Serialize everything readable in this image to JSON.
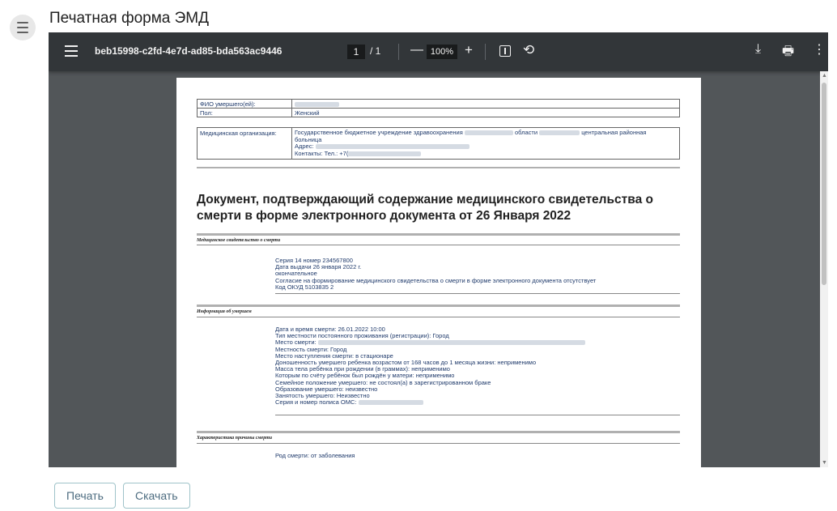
{
  "header": {
    "title": "Печатная форма ЭМД"
  },
  "viewer": {
    "file_name": "beb15998-c2fd-4e7d-ad85-bda563ac9446",
    "current_page": "1",
    "page_total": "/ 1",
    "zoom_out": "—",
    "zoom": "100%",
    "zoom_in": "+",
    "rotate": "⟲",
    "download": "⤓",
    "print": "🖶",
    "more": "⋮"
  },
  "document": {
    "patient_table": {
      "name_label": "ФИО умершего(ей):",
      "name_value": "",
      "sex_label": "Пол:",
      "sex_value": "Женский"
    },
    "org_table": {
      "label": "Медицинская организация:",
      "line1_a": "Государственное бюджетное учреждение здравоохранения",
      "line1_b": "области",
      "line1_c": "центральная районная",
      "line2": "больница",
      "address_label": "Адрес:",
      "contacts_label": "Контакты: Тел.: +7("
    },
    "title": "Документ, подтверждающий содержание медицинского свидетельства о смерти в форме электронного документа от 26 Января 2022",
    "section1": {
      "title": "Медицинское свидетельство о смерти",
      "lines": [
        "Серия 14 номер 234567800",
        "Дата выдачи 26 января 2022 г.",
        "окончательное",
        "Согласие на формирование медицинского свидетельства о смерти в форме электронного документа отсутствует",
        "Код ОКУД 5103835 2"
      ]
    },
    "section2": {
      "title": "Информация об умершем",
      "lines": [
        "Дата и время смерти: 26.01.2022 10:00",
        "Тип местности постоянного проживания (регистрации): Город",
        "Место смерти:",
        "Местность смерти: Город",
        "Место наступления смерти: в стационаре",
        "Доношенность умершего ребенка возрастом от 168 часов до 1 месяца жизни: неприменимо",
        "Масса тела ребёнка при рождении (в граммах): неприменимо",
        "Которым по счёту ребёнок был рождён у матери: неприменимо",
        "Семейное положение умершего: не состоял(а) в зарегистрированном браке",
        "Образование умершего: неизвестно",
        "Занятость умершего: Неизвестно",
        "Серия и номер полиса ОМС:"
      ]
    },
    "section3": {
      "title": "Характеристика причины смерти",
      "lines": [
        "Род смерти: от заболевания"
      ]
    }
  },
  "footer": {
    "print_label": "Печать",
    "download_label": "Скачать"
  }
}
